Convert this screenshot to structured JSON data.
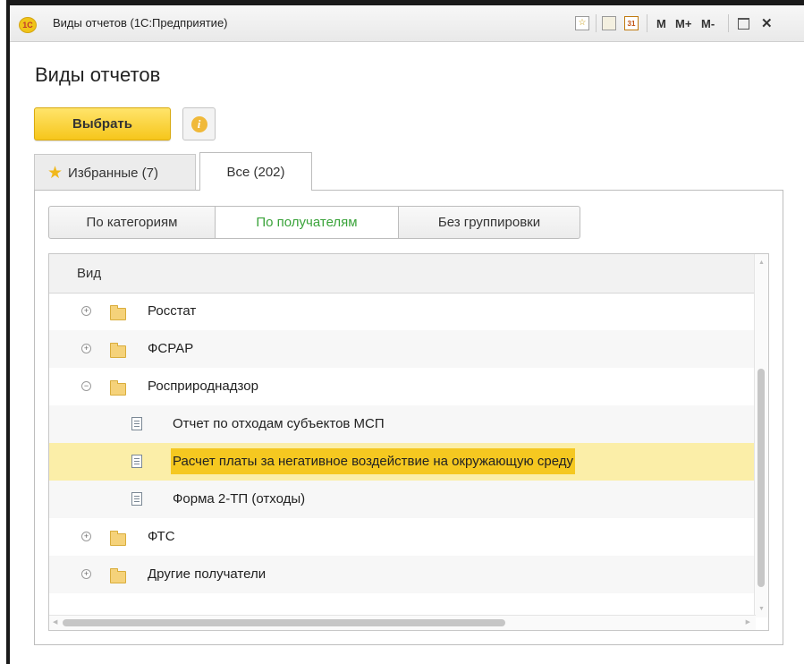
{
  "window": {
    "title": "Виды отчетов  (1С:Предприятие)",
    "logo_text": "1С",
    "toolbar": {
      "m": "M",
      "m_plus": "M+",
      "m_minus": "M-",
      "close": "✕",
      "calendar": "31"
    }
  },
  "page": {
    "title": "Виды отчетов",
    "select_label": "Выбрать",
    "info_symbol": "i"
  },
  "tabs": [
    {
      "label": "Избранные (7)",
      "active": false
    },
    {
      "label": "Все (202)",
      "active": true
    }
  ],
  "grouping": [
    {
      "label": "По категориям",
      "active": false
    },
    {
      "label": "По получателям",
      "active": true
    },
    {
      "label": "Без группировки",
      "active": false
    }
  ],
  "table": {
    "column_header": "Вид",
    "rows": [
      {
        "type": "group",
        "expanded": false,
        "label": "Росстат"
      },
      {
        "type": "group",
        "expanded": false,
        "label": "ФСРАР"
      },
      {
        "type": "group",
        "expanded": true,
        "label": "Росприроднадзор"
      },
      {
        "type": "report",
        "label": "Отчет по отходам субъектов МСП"
      },
      {
        "type": "report",
        "label": "Расчет платы за негативное воздействие на окружающую среду",
        "selected": true
      },
      {
        "type": "report",
        "label": "Форма 2-ТП (отходы)"
      },
      {
        "type": "group",
        "expanded": false,
        "label": "ФТС"
      },
      {
        "type": "group",
        "expanded": false,
        "label": "Другие получатели"
      }
    ]
  },
  "colors": {
    "accent_yellow": "#f6c61b",
    "selected_row": "#fbeea8",
    "selected_cell": "#f5c820",
    "active_group_text": "#3aa33a"
  }
}
